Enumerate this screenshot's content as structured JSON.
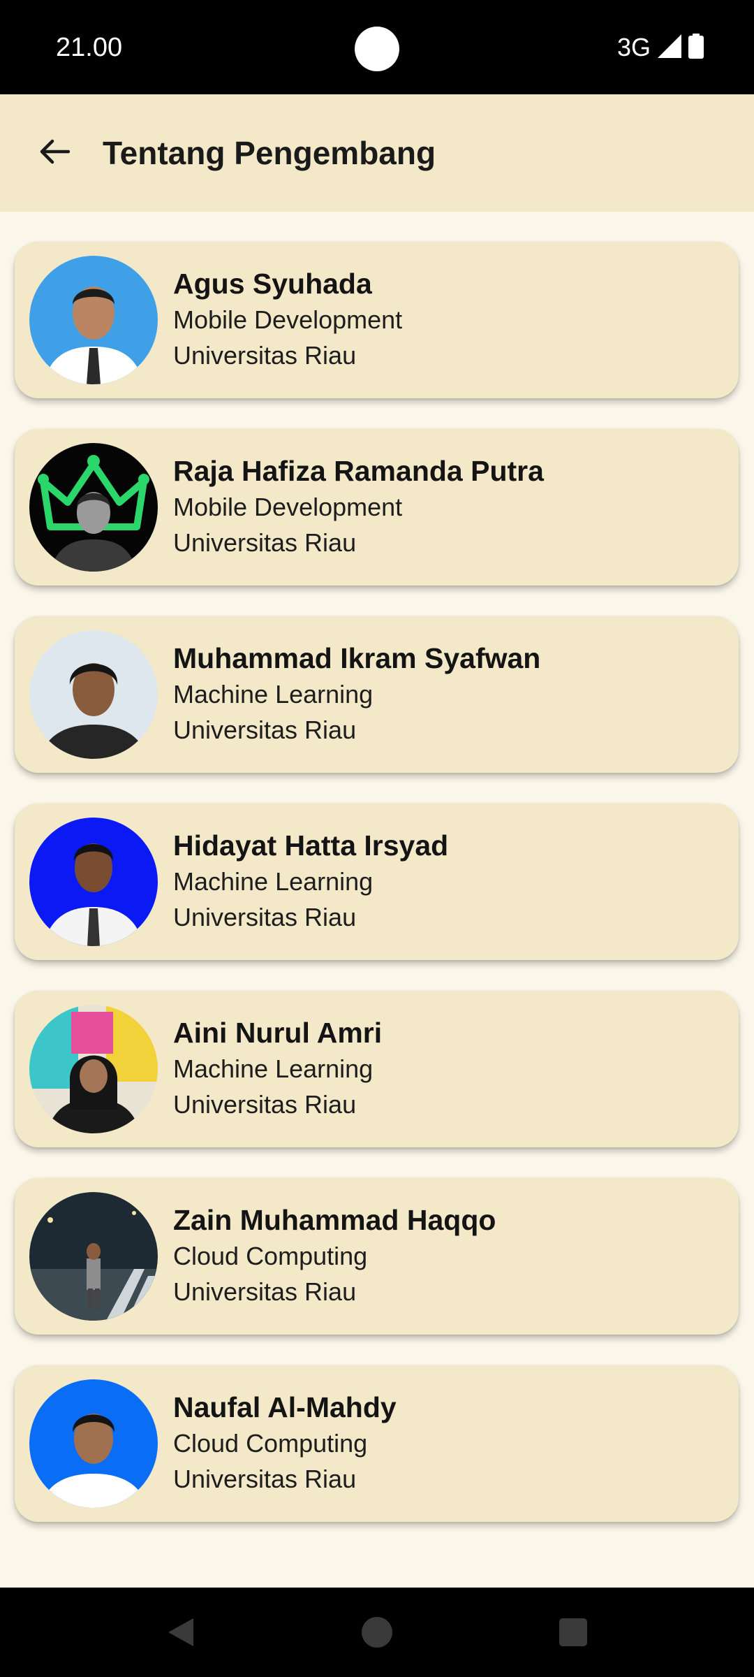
{
  "status_bar": {
    "time": "21.00",
    "network": "3G"
  },
  "app_bar": {
    "title": "Tentang Pengembang"
  },
  "developers": [
    {
      "name": "Agus Syuhada",
      "role": "Mobile Development",
      "university": "Universitas Riau"
    },
    {
      "name": "Raja Hafiza Ramanda Putra",
      "role": "Mobile Development",
      "university": "Universitas Riau"
    },
    {
      "name": "Muhammad Ikram Syafwan",
      "role": "Machine Learning",
      "university": "Universitas Riau"
    },
    {
      "name": "Hidayat Hatta Irsyad",
      "role": "Machine Learning",
      "university": "Universitas Riau"
    },
    {
      "name": "Aini Nurul Amri",
      "role": "Machine Learning",
      "university": "Universitas Riau"
    },
    {
      "name": "Zain Muhammad Haqqo",
      "role": "Cloud Computing",
      "university": "Universitas Riau"
    },
    {
      "name": "Naufal Al-Mahdy",
      "role": "Cloud Computing",
      "university": "Universitas Riau"
    }
  ],
  "icons": {
    "back": "arrow-left-icon",
    "signal": "cell-signal-icon",
    "battery": "battery-icon",
    "nav_back": "triangle-back-icon",
    "nav_home": "circle-home-icon",
    "nav_recents": "square-recents-icon"
  },
  "colors": {
    "app_bar": "#f3e9c9",
    "card": "#f3e9c9",
    "background": "#faf6ea",
    "system_bars": "#000000"
  }
}
